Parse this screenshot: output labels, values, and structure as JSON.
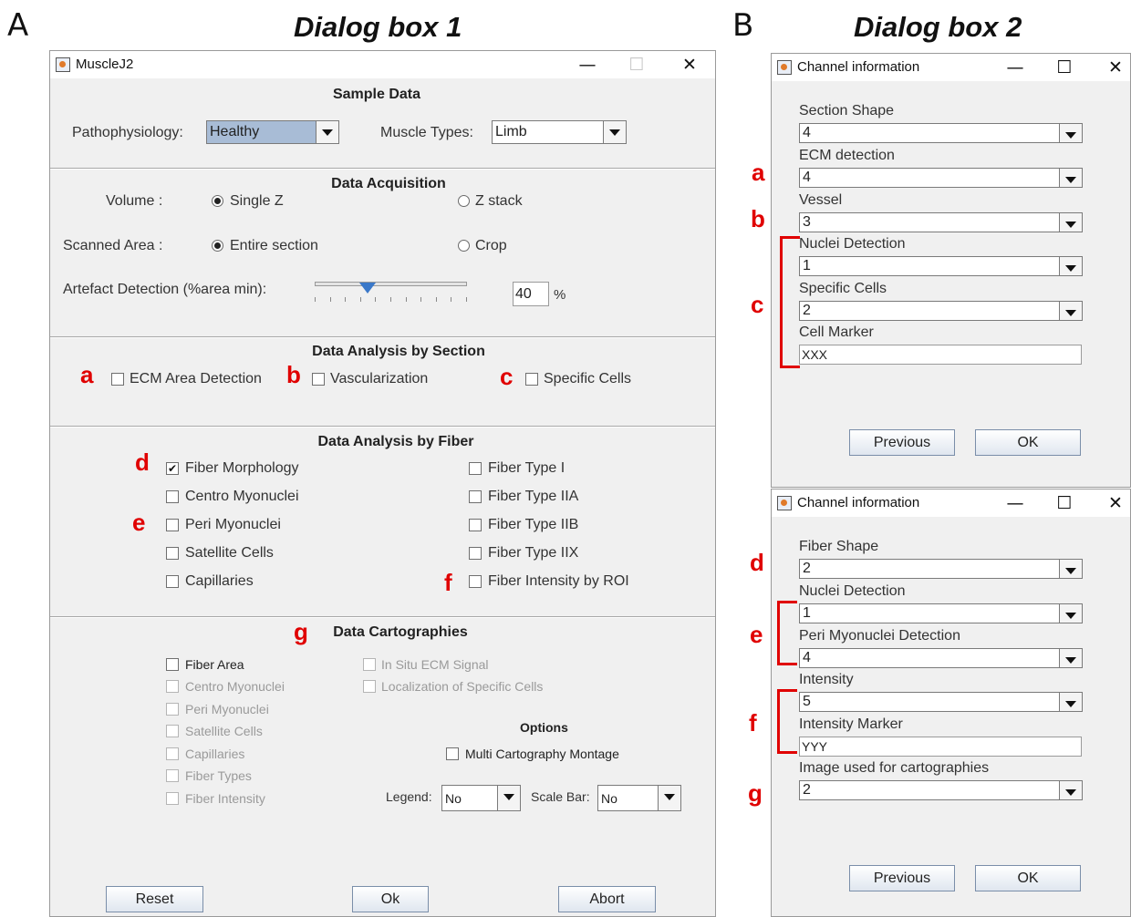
{
  "panel_a": {
    "letter": "A",
    "title": "Dialog box 1"
  },
  "panel_b": {
    "letter": "B",
    "title": "Dialog box 2"
  },
  "dialog1": {
    "window_title": "MuscleJ2",
    "sample_data": {
      "title": "Sample Data",
      "patho_label": "Pathophysiology:",
      "patho_value": "Healthy",
      "muscle_label": "Muscle Types:",
      "muscle_value": "Limb"
    },
    "acquisition": {
      "title": "Data Acquisition",
      "volume_label": "Volume :",
      "single_z": "Single Z",
      "z_stack": "Z stack",
      "scanned_label": "Scanned Area :",
      "entire_section": "Entire section",
      "crop": "Crop",
      "artefact_label": "Artefact Detection (%area min):",
      "artefact_value": "40",
      "percent": "%",
      "slider_level": 0.35
    },
    "analysis_section": {
      "title": "Data Analysis by Section",
      "ecm": "ECM Area Detection",
      "vascularization": "Vascularization",
      "specific_cells": "Specific Cells"
    },
    "analysis_fiber": {
      "title": "Data Analysis by Fiber",
      "left": [
        "Fiber Morphology",
        "Centro Myonuclei",
        "Peri Myonuclei",
        "Satellite Cells",
        "Capillaries"
      ],
      "right": [
        "Fiber Type I",
        "Fiber Type IIA",
        "Fiber Type IIB",
        "Fiber Type IIX",
        "Fiber Intensity by ROI"
      ],
      "checked_mark": "✔"
    },
    "cartographies": {
      "title": "Data Cartographies",
      "left": [
        "Fiber Area",
        "Centro Myonuclei",
        "Peri Myonuclei",
        "Satellite Cells",
        "Capillaries",
        "Fiber Types",
        "Fiber Intensity"
      ],
      "middle": [
        "In Situ ECM Signal",
        "Localization of Specific Cells"
      ],
      "options_title": "Options",
      "montage": "Multi Cartography Montage",
      "legend_label": "Legend:",
      "legend_value": "No",
      "scalebar_label": "Scale Bar:",
      "scalebar_value": "No"
    },
    "buttons": {
      "reset": "Reset",
      "ok": "Ok",
      "abort": "Abort"
    }
  },
  "dialog2a": {
    "window_title": "Channel information",
    "fields": [
      {
        "label": "Section Shape",
        "value": "4"
      },
      {
        "label": "ECM detection",
        "value": "4"
      },
      {
        "label": "Vessel",
        "value": "3"
      },
      {
        "label": "Nuclei Detection",
        "value": "1"
      },
      {
        "label": "Specific Cells",
        "value": "2"
      }
    ],
    "marker_label": "Cell Marker",
    "marker_value": "XXX",
    "previous": "Previous",
    "ok": "OK"
  },
  "dialog2b": {
    "window_title": "Channel information",
    "fields": [
      {
        "label": "Fiber Shape",
        "value": "2"
      },
      {
        "label": "Nuclei Detection",
        "value": "1"
      },
      {
        "label": "Peri Myonuclei Detection",
        "value": "4"
      },
      {
        "label": "Intensity",
        "value": "5"
      }
    ],
    "marker_label": "Intensity Marker",
    "marker_value": "YYY",
    "cartography_label": "Image used for cartographies",
    "cartography_value": "2",
    "previous": "Previous",
    "ok": "OK"
  },
  "annotations": {
    "a": "a",
    "b": "b",
    "c": "c",
    "d": "d",
    "e": "e",
    "f": "f",
    "g": "g"
  },
  "titlebar_glyphs": {
    "minimize": "—",
    "maximize": "☐",
    "close": "✕"
  }
}
